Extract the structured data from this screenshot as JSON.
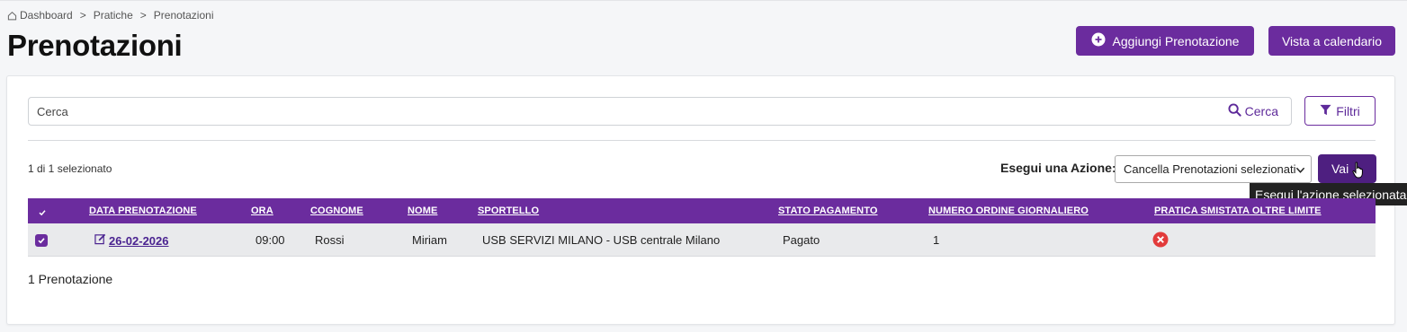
{
  "breadcrumb": {
    "items": [
      "Dashboard",
      "Pratiche",
      "Prenotazioni"
    ],
    "separator": ">"
  },
  "page": {
    "title": "Prenotazioni"
  },
  "header_buttons": {
    "add_label": "Aggiungi Prenotazione",
    "calendar_label": "Vista a calendario"
  },
  "search": {
    "placeholder": "Cerca",
    "button_label": "Cerca"
  },
  "filters": {
    "label": "Filtri"
  },
  "selection": {
    "count_text": "1 di 1 selezionato"
  },
  "action": {
    "label": "Esegui una Azione:",
    "selected": "Cancella Prenotazioni selezionati",
    "go_label": "Vai",
    "tooltip": "Esegui l'azione selezionata"
  },
  "table": {
    "columns": [
      "DATA PRENOTAZIONE",
      "ORA",
      "COGNOME",
      "NOME",
      "SPORTELLO",
      "STATO PAGAMENTO",
      "NUMERO ORDINE GIORNALIERO",
      "PRATICA SMISTATA OLTRE LIMITE"
    ],
    "rows": [
      {
        "selected": true,
        "date": "26-02-2026",
        "time": "09:00",
        "surname": "Rossi",
        "name": "Miriam",
        "counter": "USB SERVIZI MILANO - USB centrale Milano",
        "payment_status": "Pagato",
        "order_number": "1",
        "over_limit": "no"
      }
    ]
  },
  "footer": {
    "total_text": "1 Prenotazione"
  },
  "colors": {
    "primary": "#6b2c9e",
    "primary_dark": "#4e1f80",
    "danger": "#e23b3b",
    "row_bg": "#e9eaec"
  },
  "icons": {
    "home": "home-icon",
    "add": "plus-circle-icon",
    "search": "search-icon",
    "filter": "filter-icon",
    "edit": "edit-icon",
    "no": "x-circle-icon"
  }
}
